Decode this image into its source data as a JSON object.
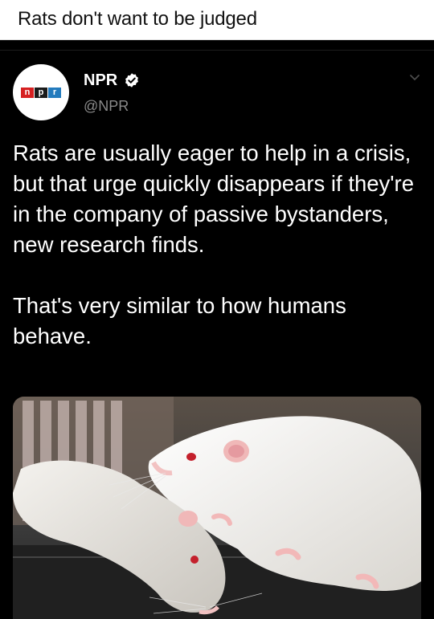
{
  "page": {
    "title": "Rats don't want to be judged"
  },
  "tweet": {
    "account_name": "NPR",
    "handle": "@NPR",
    "verified": true,
    "avatar_logo_letters": [
      "n",
      "p",
      "r"
    ],
    "paragraphs": [
      "Rats are usually eager to help in a crisis, but that urge quickly disappears if they're in the company of passive bystanders, new research finds.",
      "That's very similar to how humans behave."
    ],
    "menu_icon": "chevron-down-icon",
    "media_icon": "photo-of-two-white-rats"
  },
  "colors": {
    "title_background": "#ffffff",
    "tweet_background": "#000000",
    "text": "#ffffff",
    "handle": "#8a8a8a",
    "npr_red": "#d62021",
    "npr_black": "#1a1a1a",
    "npr_blue": "#237bbd"
  }
}
